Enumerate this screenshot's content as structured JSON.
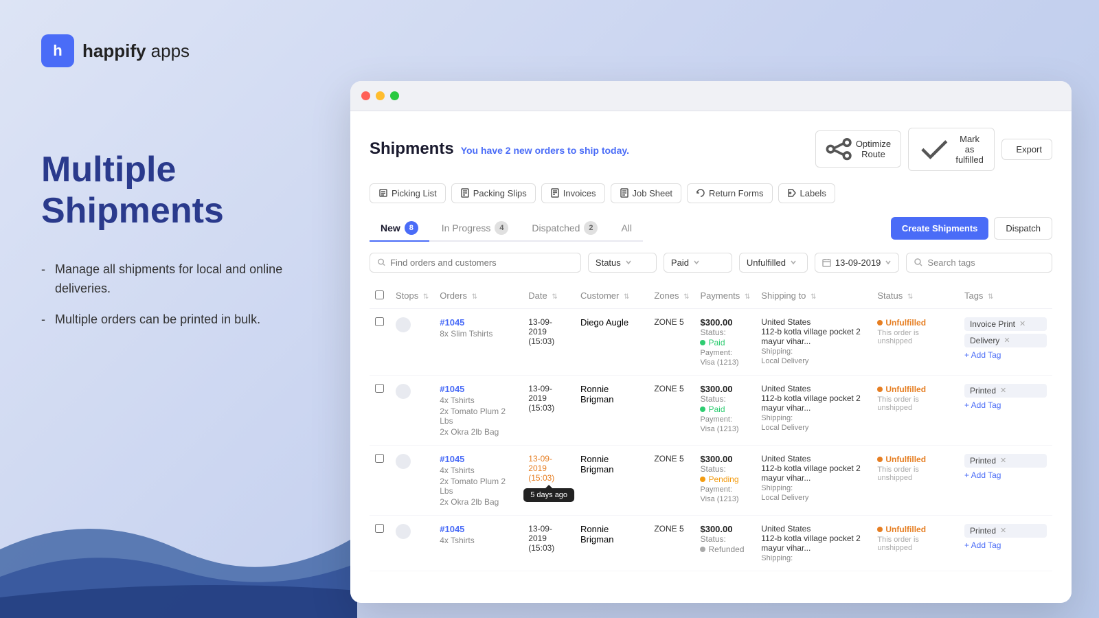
{
  "branding": {
    "logo_letter": "h",
    "app_name_bold": "happify",
    "app_name_light": " apps"
  },
  "hero": {
    "title": "Multiple\nShipments",
    "bullets": [
      "Manage all shipments for local and online deliveries.",
      "Multiple orders can be printed in bulk."
    ]
  },
  "window": {
    "title_bar": {
      "lights": [
        "red",
        "yellow",
        "green"
      ]
    }
  },
  "page": {
    "title": "Shipments",
    "notice": "You have",
    "notice_count": "2",
    "notice_suffix": "new orders to ship today."
  },
  "toolbar": {
    "buttons": [
      {
        "label": "Picking List",
        "icon": "list"
      },
      {
        "label": "Packing Slips",
        "icon": "slip"
      },
      {
        "label": "Invoices",
        "icon": "invoice"
      },
      {
        "label": "Job Sheet",
        "icon": "sheet"
      },
      {
        "label": "Return Forms",
        "icon": "return"
      },
      {
        "label": "Labels",
        "icon": "label"
      }
    ]
  },
  "header_actions": {
    "optimize": "Optimize Route",
    "mark_fulfilled": "Mark as fulfilled",
    "export": "Export"
  },
  "tabs": [
    {
      "label": "New",
      "badge": "8",
      "active": true
    },
    {
      "label": "In Progress",
      "badge": "4",
      "active": false
    },
    {
      "label": "Dispatched",
      "badge": "2",
      "active": false
    },
    {
      "label": "All",
      "badge": "",
      "active": false
    }
  ],
  "tab_actions": {
    "create_shipment": "Create Shipments",
    "dispatch": "Dispatch"
  },
  "filters": {
    "search_placeholder": "Find orders and customers",
    "status_label": "Status",
    "paid_label": "Paid",
    "unfulfilled_label": "Unfulfilled",
    "date_label": "13-09-2019",
    "tags_placeholder": "Search tags"
  },
  "table": {
    "columns": [
      "",
      "",
      "Orders",
      "Date",
      "Customer",
      "Zones",
      "Payments",
      "Shipping to",
      "Status",
      "Tags"
    ],
    "rows": [
      {
        "id": 1,
        "order": "#1045",
        "items": "8x Slim Tshirts",
        "date": "13-09-2019",
        "time": "(15:03)",
        "customer": "Diego Augle",
        "zone": "ZONE 5",
        "amount": "$300.00",
        "payment_status": "Paid",
        "payment_type": "Visa (1213)",
        "shipping_country": "United States",
        "shipping_address": "112-b kotla village pocket 2 mayur vihar...",
        "shipping_method": "Shipping:\nLocal Delivery",
        "order_status": "Unfulfilled",
        "order_note": "This order is unshipped",
        "tags": [
          "Invoice Print",
          "Delivery"
        ],
        "add_tag": "+ Add Tag",
        "payment_dot": "green"
      },
      {
        "id": 2,
        "order": "#1045",
        "items": "4x Tshirts\n2x Tomato Plum 2 Lbs\n2x Okra 2lb Bag",
        "date": "13-09-2019",
        "time": "(15:03)",
        "customer": "Ronnie Brigman",
        "zone": "ZONE 5",
        "amount": "$300.00",
        "payment_status": "Paid",
        "payment_type": "Visa (1213)",
        "shipping_country": "United States",
        "shipping_address": "112-b kotla village pocket 2 mayur vihar...",
        "shipping_method": "Shipping:\nLocal Delivery",
        "order_status": "Unfulfilled",
        "order_note": "This order is unshipped",
        "tags": [
          "Printed"
        ],
        "add_tag": "+ Add Tag",
        "payment_dot": "green"
      },
      {
        "id": 3,
        "order": "#1045",
        "items": "4x Tshirts\n2x Tomato Plum 2 Lbs\n2x Okra 2lb Bag",
        "date": "13-09-2019",
        "time": "(15:03)",
        "customer": "Ronnie Brigman",
        "zone": "ZONE 5",
        "amount": "$300.00",
        "payment_status": "Pending",
        "payment_type": "Visa (1213)",
        "shipping_country": "United States",
        "shipping_address": "112-b kotla village pocket 2 mayur vihar...",
        "shipping_method": "Shipping:\nLocal Delivery",
        "order_status": "Unfulfilled",
        "order_note": "This order is unshipped",
        "tags": [
          "Printed"
        ],
        "add_tag": "+ Add Tag",
        "payment_dot": "orange",
        "show_tooltip": true,
        "tooltip_text": "5 days ago",
        "date_highlight": true
      },
      {
        "id": 4,
        "order": "#1045",
        "items": "4x Tshirts",
        "date": "13-09-2019",
        "time": "(15:03)",
        "customer": "Ronnie Brigman",
        "zone": "ZONE 5",
        "amount": "$300.00",
        "payment_status": "Refunded",
        "payment_type": "",
        "shipping_country": "United States",
        "shipping_address": "112-b kotla village pocket 2 mayur vihar...",
        "shipping_method": "Shipping:",
        "order_status": "Unfulfilled",
        "order_note": "This order is unshipped",
        "tags": [
          "Printed"
        ],
        "add_tag": "+ Add Tag",
        "payment_dot": "gray"
      }
    ]
  }
}
